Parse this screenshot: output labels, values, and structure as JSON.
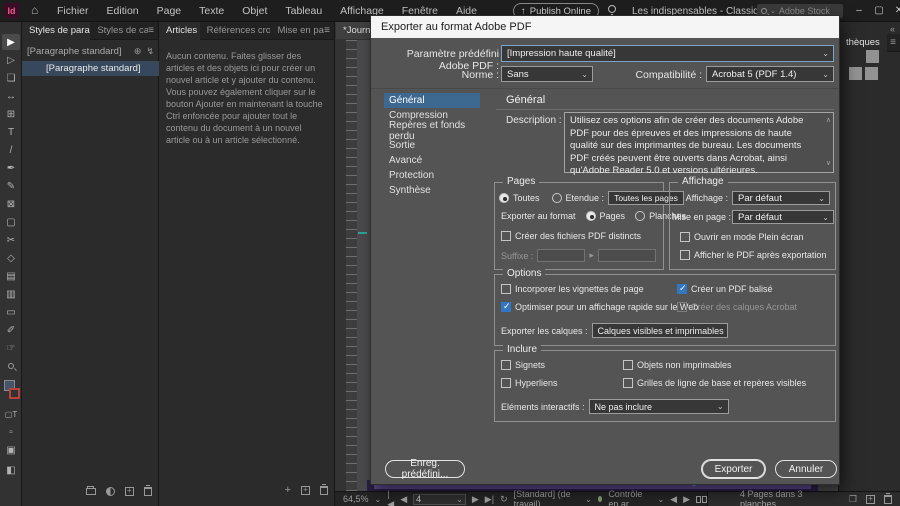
{
  "colors": {
    "logo_pink": "#ec5a8f",
    "checkbox_blue": "#3377c2",
    "selected_row": "#37485c",
    "list_selected": "#3d6890",
    "page_purple": "#5a4a8c"
  },
  "icons": {
    "chevron_down": "⌄",
    "panel_menu": "≡",
    "collapse_right": "«",
    "home": "⌂",
    "share": "↑",
    "minimize": "–",
    "maximize": "▢",
    "close": "✕",
    "first_page": "|◀",
    "prev_page": "◀",
    "next_page": "▶",
    "last_page": "▶|",
    "preflight_arrow": "↻",
    "plus": "+",
    "suffix_arrow": "▸",
    "scroll_up": "∧",
    "scroll_down": "∨",
    "style_add": "⊕",
    "style_lightning": "↯",
    "page_tool_extra": "❐"
  },
  "tools": [
    {
      "glyph": "▶"
    },
    {
      "glyph": "▷"
    },
    {
      "glyph": "❏"
    },
    {
      "glyph": "↔"
    },
    {
      "glyph": "⊞"
    },
    {
      "glyph": "T"
    },
    {
      "glyph": "/"
    },
    {
      "glyph": "✒"
    },
    {
      "glyph": "✎"
    },
    {
      "glyph": "⊠"
    },
    {
      "glyph": "▢"
    },
    {
      "glyph": "✂"
    },
    {
      "glyph": "◇"
    },
    {
      "glyph": "▤"
    },
    {
      "glyph": "▥"
    },
    {
      "glyph": "▭"
    },
    {
      "glyph": "✐"
    },
    {
      "glyph": "☞"
    },
    {
      "glyph": "▢T"
    },
    {
      "glyph": "▫"
    },
    {
      "glyph": "▣"
    },
    {
      "glyph": "◧"
    }
  ],
  "menubar": {
    "logo": "Id",
    "items": [
      "Fichier",
      "Edition",
      "Page",
      "Texte",
      "Objet",
      "Tableau",
      "Affichage",
      "Fenêtre",
      "Aide"
    ],
    "publish_online": "Publish Online",
    "workspace": "Les indispensables - Classique",
    "search_placeholder": "Adobe Stock"
  },
  "panels": {
    "styles": {
      "tab_paragraph": "Styles de paragraphe",
      "tab_character": "Styles de caractè",
      "field_value": "[Paragraphe standard]",
      "selected_item": "[Paragraphe standard]"
    },
    "articles": {
      "tab_articles": "Articles",
      "tab_references": "Références croi",
      "tab_misenpage": "Mise en pa",
      "empty_text": "Aucun contenu. Faites glisser des articles et des objets ici pour créer un nouvel article et y ajouter du contenu. Vous pouvez également cliquer sur le bouton Ajouter en maintenant la touche Ctrl enfoncée pour ajouter tout le contenu du document à un nouvel article ou à un article sélectionné."
    },
    "libraries": {
      "tab": "thèques"
    }
  },
  "document": {
    "tab_title": "*Journey"
  },
  "dialog": {
    "title": "Exporter au format Adobe PDF",
    "preset_label": "Paramètre prédéfini Adobe PDF :",
    "preset_value": "[Impression haute qualité]",
    "norme_label": "Norme :",
    "norme_value": "Sans",
    "compat_label": "Compatibilité :",
    "compat_value": "Acrobat 5 (PDF 1.4)",
    "sections": [
      "Général",
      "Compression",
      "Repères et fonds perdu",
      "Sortie",
      "Avancé",
      "Protection",
      "Synthèse"
    ],
    "heading": "Général",
    "description_label": "Description :",
    "description_text": "Utilisez ces options afin de créer des documents Adobe PDF pour des épreuves et des impressions de haute qualité sur des imprimantes de bureau. Les documents PDF créés peuvent être ouverts dans Acrobat, ainsi qu'Adobe Reader 5.0 et versions ultérieures.",
    "pages": {
      "legend": "Pages",
      "toutes": "Toutes",
      "etendue": "Etendue :",
      "etendue_value": "Toutes les pages",
      "export_format": "Exporter au format",
      "pages": "Pages",
      "planches": "Planches",
      "distinct": "Créer des fichiers PDF distincts",
      "suffixe": "Suffixe :",
      "suffixe_value": "",
      "suffixe_value2": ""
    },
    "affichage": {
      "legend": "Affichage",
      "affichage_label": "Affichage :",
      "affichage_value": "Par défaut",
      "mise_label": "Mise en page :",
      "mise_value": "Par défaut",
      "fullscreen": "Ouvrir en mode Plein écran",
      "after_export": "Afficher le PDF après exportation"
    },
    "options": {
      "legend": "Options",
      "vignettes": "Incorporer les vignettes de page",
      "balise": "Créer un PDF balisé",
      "optimiser": "Optimiser pour un affichage rapide sur le Web",
      "calques_acrobat": "Créer des calques Acrobat",
      "export_calques_label": "Exporter les calques :",
      "export_calques_value": "Calques visibles et imprimables"
    },
    "inclure": {
      "legend": "Inclure",
      "signets": "Signets",
      "objets": "Objets non imprimables",
      "hyperliens": "Hyperliens",
      "grilles": "Grilles de ligne de base et repères visibles",
      "elements_label": "Eléments interactifs :",
      "elements_value": "Ne pas inclure"
    },
    "save_preset": "Enreg. prédéfini...",
    "export": "Exporter",
    "cancel": "Annuler"
  },
  "statusbar": {
    "zoom_level": "64,5%",
    "current_page": "4",
    "preflight_profile": "[Standard] (de travail)",
    "preflight_status": "Contrôle en ar",
    "pages_info": "4 Pages dans 3 planches"
  }
}
